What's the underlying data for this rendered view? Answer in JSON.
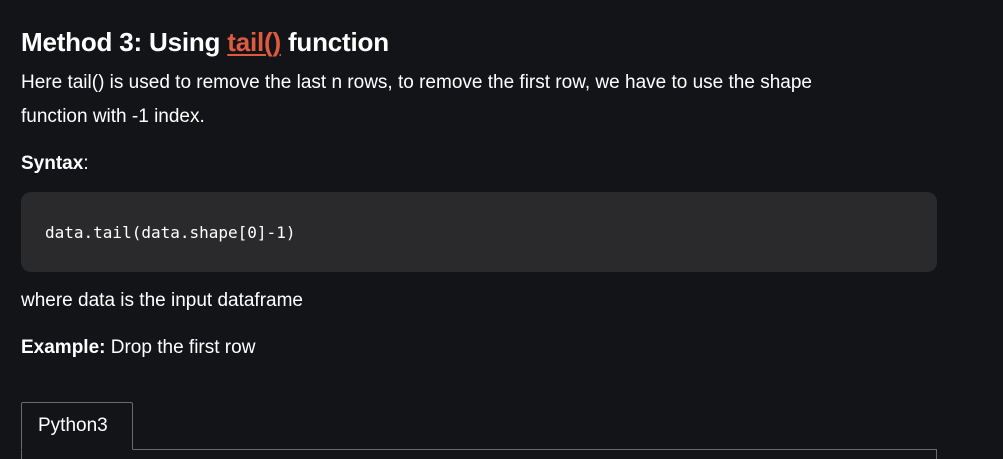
{
  "heading": {
    "prefix": "Method 3: Using ",
    "link": "tail()",
    "suffix": " function"
  },
  "intro": {
    "line1": "Here tail() is used to remove the last n rows, to remove the first row, we have to use the shape",
    "line2": "function with -1 index."
  },
  "syntax": {
    "label": "Syntax",
    "colon": ":"
  },
  "code": "data.tail(data.shape[0]-1)",
  "where": "where data is the input dataframe",
  "example": {
    "label": "Example:",
    "text": " Drop the first row"
  },
  "tabs": [
    "Python3"
  ],
  "colors": {
    "background": "#131417",
    "link": "#e05a3f",
    "code_background": "#2a2a2d"
  }
}
